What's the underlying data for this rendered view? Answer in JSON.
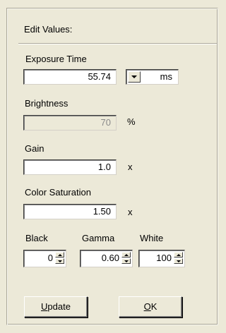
{
  "group_title": "Edit Values:",
  "exposure": {
    "label": "Exposure Time",
    "value": "55.74",
    "unit": "ms"
  },
  "brightness": {
    "label": "Brightness",
    "value": "70",
    "unit": "%"
  },
  "gain": {
    "label": "Gain",
    "value": "1.0",
    "unit": "x"
  },
  "saturation": {
    "label": "Color Saturation",
    "value": "1.50",
    "unit": "x"
  },
  "levels": {
    "black_label": "Black",
    "black_value": "0",
    "gamma_label": "Gamma",
    "gamma_value": "0.60",
    "white_label": "White",
    "white_value": "100"
  },
  "buttons": {
    "update_mnemonic": "U",
    "update_rest": "pdate",
    "ok_mnemonic": "O",
    "ok_rest": "K"
  },
  "icons": {
    "dropdown": "chevron-down-icon",
    "spin_up": "spin-up-icon",
    "spin_down": "spin-down-icon"
  }
}
